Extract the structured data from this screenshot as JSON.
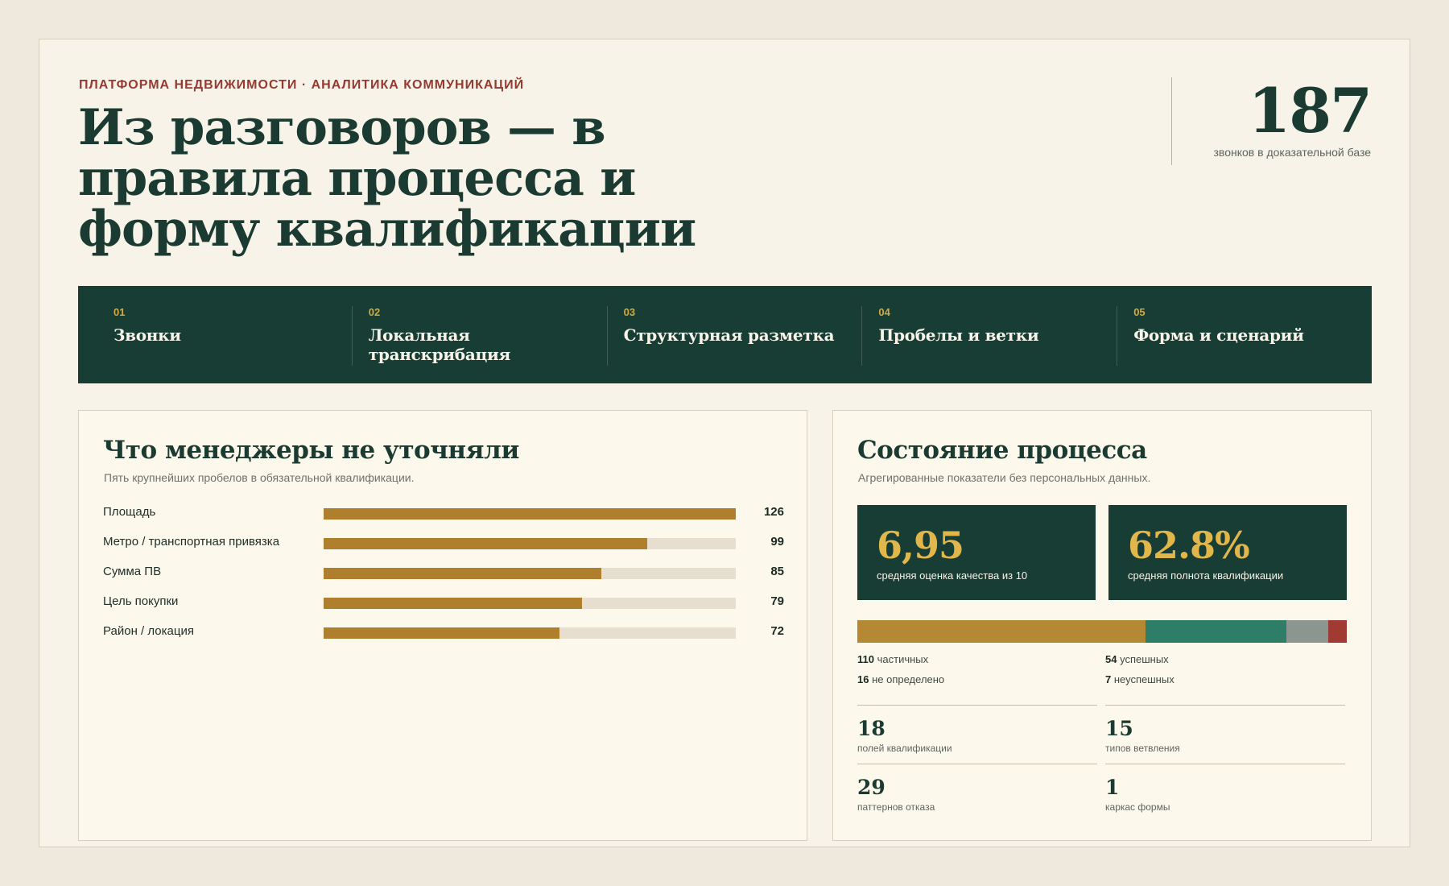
{
  "header": {
    "eyebrow": "ПЛАТФОРМА НЕДВИЖИМОСТИ · АНАЛИТИКА КОММУНИКАЦИЙ",
    "title": "Из разговоров — в правила процесса и форму квалификации",
    "calls_value": "187",
    "calls_caption": "звонков в доказательной базе"
  },
  "steps": [
    {
      "num": "01",
      "label": "Звонки"
    },
    {
      "num": "02",
      "label": "Локальная транскрибация"
    },
    {
      "num": "03",
      "label": "Структурная разметка"
    },
    {
      "num": "04",
      "label": "Пробелы и ветки"
    },
    {
      "num": "05",
      "label": "Форма и сценарий"
    }
  ],
  "gaps": {
    "title": "Что менеджеры не уточняли",
    "subtitle": "Пять крупнейших пробелов в обязательной квалификации.",
    "max": 126,
    "items": [
      {
        "label": "Площадь",
        "value": "126",
        "n": 126
      },
      {
        "label": "Метро / транспортная привязка",
        "value": "99",
        "n": 99
      },
      {
        "label": "Сумма ПВ",
        "value": "85",
        "n": 85
      },
      {
        "label": "Цель покупки",
        "value": "79",
        "n": 79
      },
      {
        "label": "Район / локация",
        "value": "72",
        "n": 72
      }
    ]
  },
  "process": {
    "title": "Состояние процесса",
    "subtitle": "Агрегированные показатели без персональных данных.",
    "kpis": [
      {
        "value": "6,95",
        "caption": "средняя оценка качества из 10"
      },
      {
        "value": "62.8%",
        "caption": "средняя полнота квалификации"
      }
    ],
    "outcomes": [
      {
        "count": "110",
        "label": "частичных",
        "n": 110,
        "color": "#b58933"
      },
      {
        "count": "54",
        "label": "успешных",
        "n": 54,
        "color": "#2e7d66"
      },
      {
        "count": "16",
        "label": "не определено",
        "n": 16,
        "color": "#8c9690"
      },
      {
        "count": "7",
        "label": "неуспешных",
        "n": 7,
        "color": "#a03a33"
      }
    ],
    "metrics": [
      {
        "value": "18",
        "caption": "полей квалификации"
      },
      {
        "value": "15",
        "caption": "типов ветвления"
      },
      {
        "value": "29",
        "caption": "паттернов отказа"
      },
      {
        "value": "1",
        "caption": "каркас формы"
      }
    ]
  }
}
